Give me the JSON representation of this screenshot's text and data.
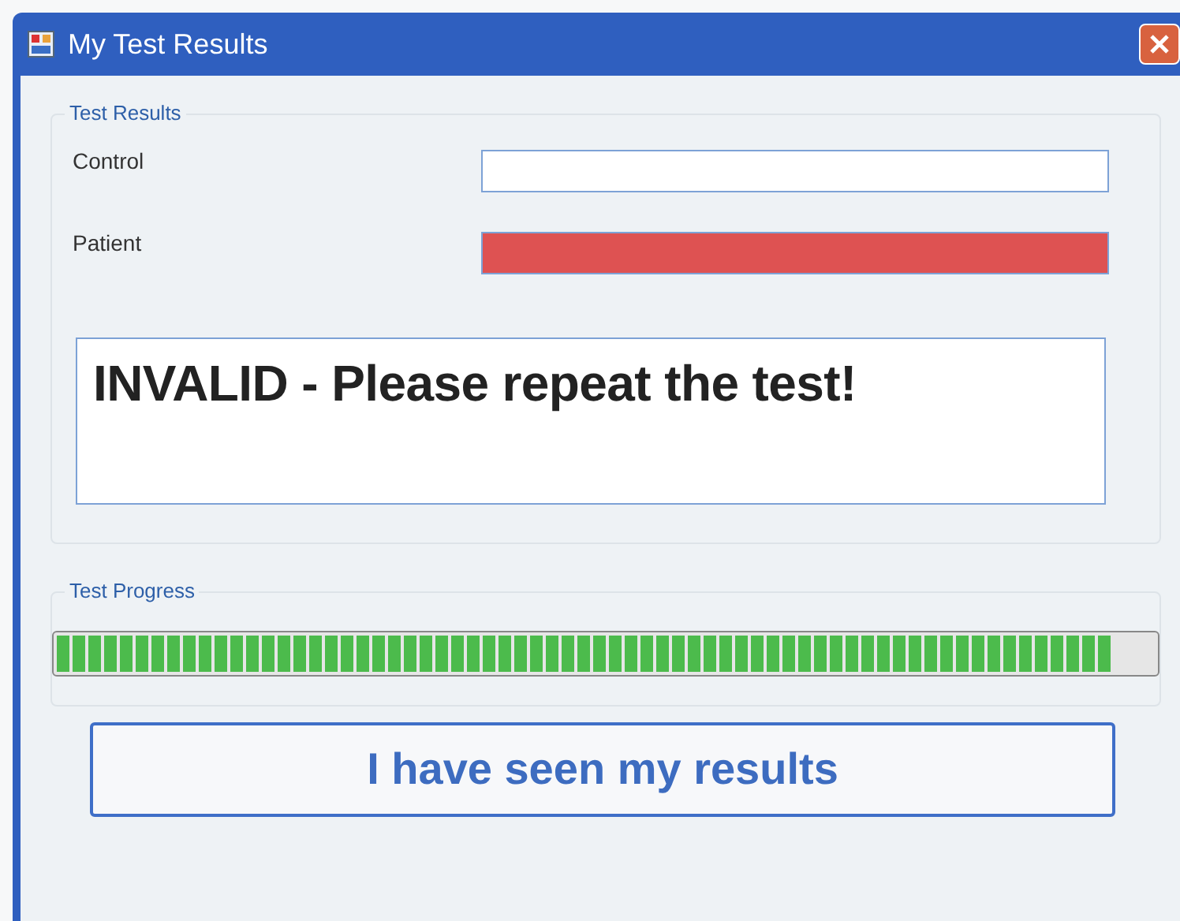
{
  "window": {
    "title": "My Test Results"
  },
  "results": {
    "title": "Test Results",
    "rows": [
      {
        "label": "Control",
        "color": "#ffffff"
      },
      {
        "label": "Patient",
        "color": "#de5252"
      }
    ],
    "message": "INVALID - Please repeat the test!"
  },
  "progress": {
    "title": "Test Progress",
    "level": 1
  },
  "button": "I have seen my results"
}
